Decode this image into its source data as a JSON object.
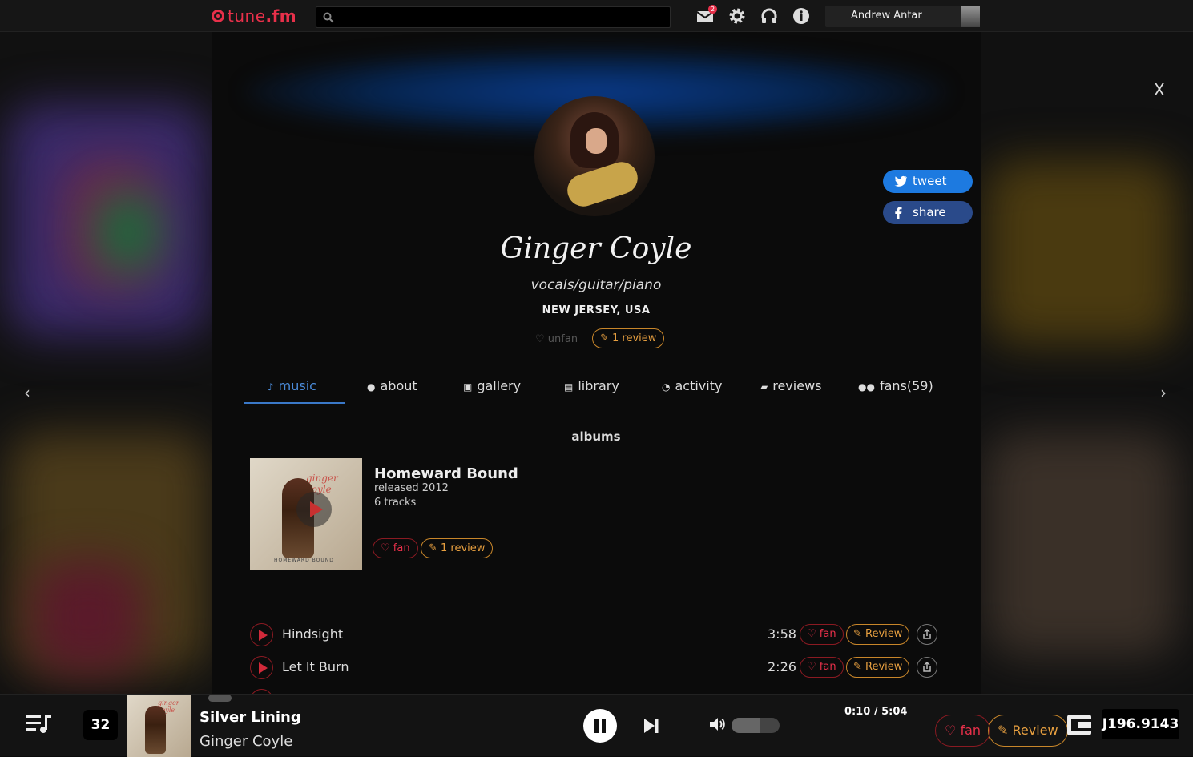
{
  "topbar": {
    "logo_text": "tune",
    "logo_suffix": ".fm",
    "search_placeholder": "",
    "mail_badge": "2",
    "user_name": "Andrew Antar"
  },
  "profile": {
    "name": "Ginger Coyle",
    "role": "vocals/guitar/piano",
    "location": "NEW JERSEY, USA",
    "unfan_label": "unfan",
    "review_label": "1 review"
  },
  "social": {
    "tweet_label": "tweet",
    "share_label": "share"
  },
  "nav": {
    "close_label": "X",
    "prev_label": "‹",
    "next_label": "›"
  },
  "tabs": [
    {
      "label": "music",
      "icon": "music-note-icon",
      "active": true
    },
    {
      "label": "about",
      "icon": "person-icon"
    },
    {
      "label": "gallery",
      "icon": "image-icon"
    },
    {
      "label": "library",
      "icon": "library-icon"
    },
    {
      "label": "activity",
      "icon": "rss-icon"
    },
    {
      "label": "reviews",
      "icon": "review-icon"
    },
    {
      "label": "fans(59)",
      "icon": "people-icon"
    }
  ],
  "albums": {
    "heading": "albums",
    "items": [
      {
        "title": "Homeward Bound",
        "released": "released 2012",
        "tracks": "6 tracks",
        "fan_label": "fan",
        "review_label": "1 review",
        "cover_text": "ginger coyle",
        "cover_bottom_text": "HOMEWARD BOUND"
      }
    ]
  },
  "tracks": [
    {
      "name": "Hindsight",
      "duration": "3:58",
      "fan_label": "fan",
      "review_label": "Review"
    },
    {
      "name": "Let It Burn",
      "duration": "2:26",
      "fan_label": "fan",
      "review_label": "Review"
    }
  ],
  "player": {
    "queue_count": "32",
    "song": "Silver Lining",
    "artist": "Ginger Coyle",
    "time": "0:10 / 5:04",
    "volume": 0.6,
    "fan_label": "fan",
    "review_label": "Review",
    "balance": "J196.9143",
    "cover_text": "ginger coyle"
  },
  "colors": {
    "accent_red": "#e8304a",
    "review_orange": "#e8a040",
    "tab_active_blue": "#4a8ad8",
    "twitter_blue": "#1d7ae0",
    "facebook_blue": "#2a4a8a"
  }
}
